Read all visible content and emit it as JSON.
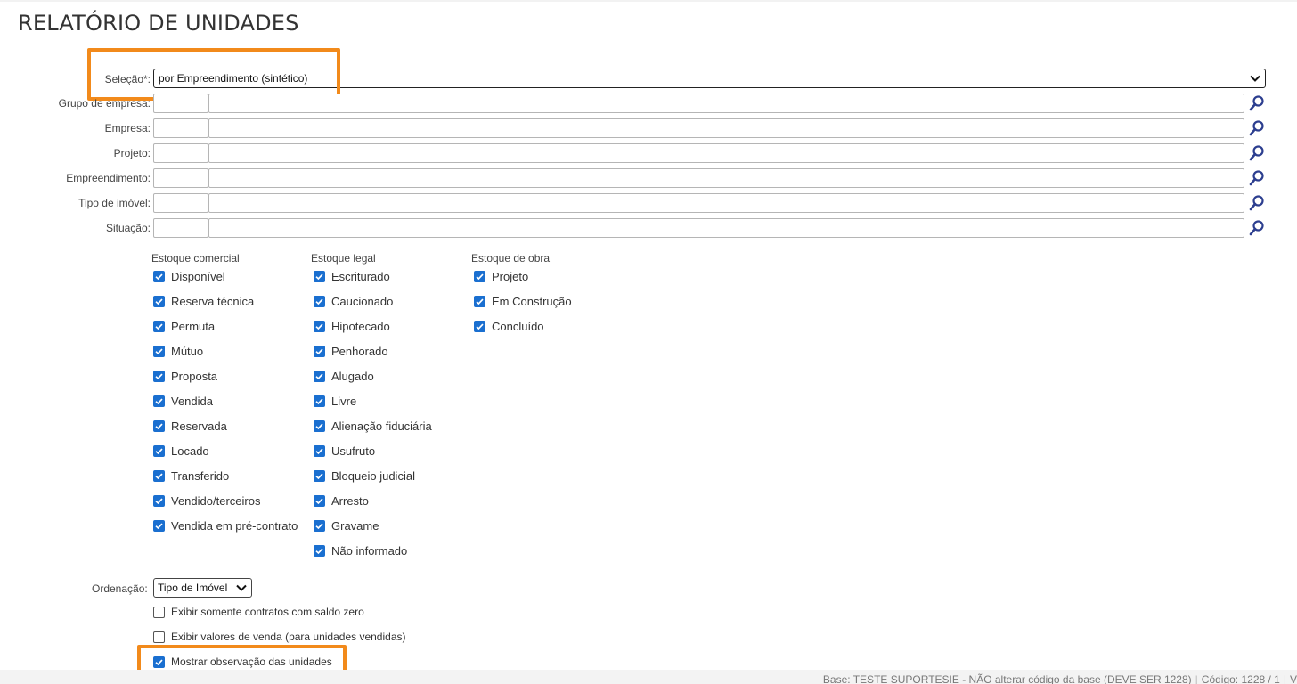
{
  "page": {
    "title": "RELATÓRIO DE UNIDADES"
  },
  "selecao": {
    "label": "Seleção*:",
    "value": "por Empreendimento (sintético)"
  },
  "filters": [
    {
      "label": "Grupo de empresa:"
    },
    {
      "label": "Empresa:"
    },
    {
      "label": "Projeto:"
    },
    {
      "label": "Empreendimento:"
    },
    {
      "label": "Tipo de imóvel:"
    },
    {
      "label": "Situação:"
    }
  ],
  "stock_groups": [
    {
      "title": "Estoque comercial",
      "items": [
        {
          "label": "Disponível",
          "checked": true
        },
        {
          "label": "Reserva técnica",
          "checked": true
        },
        {
          "label": "Permuta",
          "checked": true
        },
        {
          "label": "Mútuo",
          "checked": true
        },
        {
          "label": "Proposta",
          "checked": true
        },
        {
          "label": "Vendida",
          "checked": true
        },
        {
          "label": "Reservada",
          "checked": true
        },
        {
          "label": "Locado",
          "checked": true
        },
        {
          "label": "Transferido",
          "checked": true
        },
        {
          "label": "Vendido/terceiros",
          "checked": true
        },
        {
          "label": "Vendida em pré-contrato",
          "checked": true
        }
      ]
    },
    {
      "title": "Estoque legal",
      "items": [
        {
          "label": "Escriturado",
          "checked": true
        },
        {
          "label": "Caucionado",
          "checked": true
        },
        {
          "label": "Hipotecado",
          "checked": true
        },
        {
          "label": "Penhorado",
          "checked": true
        },
        {
          "label": "Alugado",
          "checked": true
        },
        {
          "label": "Livre",
          "checked": true
        },
        {
          "label": "Alienação fiduciária",
          "checked": true
        },
        {
          "label": "Usufruto",
          "checked": true
        },
        {
          "label": "Bloqueio judicial",
          "checked": true
        },
        {
          "label": "Arresto",
          "checked": true
        },
        {
          "label": "Gravame",
          "checked": true
        },
        {
          "label": "Não informado",
          "checked": true
        }
      ]
    },
    {
      "title": "Estoque de obra",
      "items": [
        {
          "label": "Projeto",
          "checked": true
        },
        {
          "label": "Em Construção",
          "checked": true
        },
        {
          "label": "Concluído",
          "checked": true
        }
      ]
    }
  ],
  "ordenacao": {
    "label": "Ordenação:",
    "value": "Tipo de Imóvel"
  },
  "options": [
    {
      "label": "Exibir somente contratos com saldo zero",
      "checked": false
    },
    {
      "label": "Exibir valores de venda (para unidades vendidas)",
      "checked": false
    },
    {
      "label": "Mostrar observação das unidades",
      "checked": true
    }
  ],
  "footer": {
    "base": "Base: TESTE SUPORTESIE - NÃO alterar código da base (DEVE SER 1228)",
    "codigo": "Código: 1228 / 1",
    "extra": "V"
  },
  "colors": {
    "highlight": "#f28a1b",
    "checkbox": "#1a6fd0",
    "search_icon": "#2c3e8f"
  }
}
